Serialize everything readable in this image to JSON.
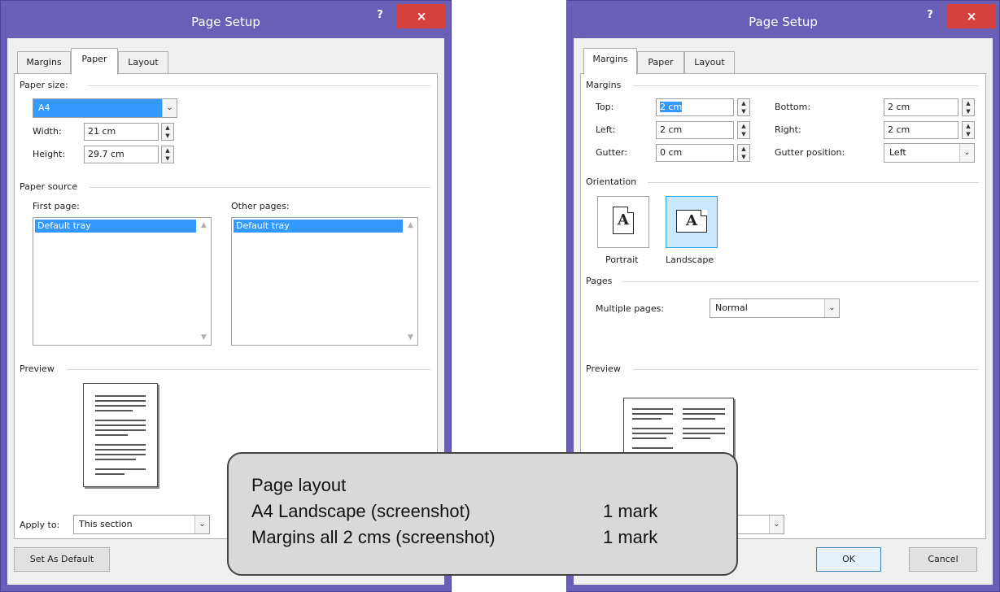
{
  "left_dialog": {
    "title": "Page Setup",
    "help": "?",
    "close": "×",
    "tabs": [
      "Margins",
      "Paper",
      "Layout"
    ],
    "paper_size": {
      "group_label": "Paper size:",
      "value": "A4",
      "width_label": "Width:",
      "width_value": "21 cm",
      "height_label": "Height:",
      "height_value": "29.7 cm"
    },
    "paper_source": {
      "group_label": "Paper source",
      "first_page_label": "First page:",
      "first_page_item": "Default tray",
      "other_pages_label": "Other pages:",
      "other_pages_item": "Default tray"
    },
    "preview_label": "Preview",
    "apply_to_label": "Apply to:",
    "apply_to_value": "This section",
    "set_default_label": "Set As Default"
  },
  "right_dialog": {
    "title": "Page Setup",
    "help": "?",
    "close": "×",
    "tabs": [
      "Margins",
      "Paper",
      "Layout"
    ],
    "margins": {
      "group_label": "Margins",
      "top_label": "Top:",
      "top_value": "2 cm",
      "bottom_label": "Bottom:",
      "bottom_value": "2 cm",
      "left_label": "Left:",
      "left_value": "2 cm",
      "right_label": "Right:",
      "right_value": "2 cm",
      "gutter_label": "Gutter:",
      "gutter_value": "0 cm",
      "gutter_position_label": "Gutter position:",
      "gutter_position_value": "Left"
    },
    "orientation": {
      "group_label": "Orientation",
      "portrait_label": "Portrait",
      "landscape_label": "Landscape",
      "glyph": "A"
    },
    "pages": {
      "group_label": "Pages",
      "multiple_pages_label": "Multiple pages:",
      "multiple_pages_value": "Normal"
    },
    "preview_label": "Preview",
    "ok_label": "OK",
    "cancel_label": "Cancel"
  },
  "callout": {
    "title": "Page layout",
    "rows": [
      {
        "text": "A4 Landscape (screenshot)",
        "mark": "1 mark"
      },
      {
        "text": "Margins all 2 cms (screenshot)",
        "mark": "1 mark"
      }
    ]
  },
  "colors": {
    "title_bar": "#6a5fb6",
    "close_button": "#d5403c",
    "selection": "#3399ff",
    "callout_bg": "#d9d9d9"
  },
  "icons": {
    "close": "close-icon",
    "help": "help-icon",
    "dropdown": "chevron-down-icon",
    "spinner": "spinner-arrows-icon",
    "portrait": "portrait-page-icon",
    "landscape": "landscape-page-icon"
  }
}
